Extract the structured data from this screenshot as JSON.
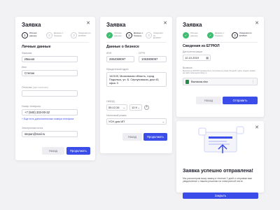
{
  "form_personal": {
    "title": "Заявка",
    "steps": [
      {
        "num": "1",
        "label": "Личные данные"
      },
      {
        "num": "2",
        "label": "Данные о бизнесе"
      },
      {
        "num": "3",
        "label": "Сведения из ЕГРЮЛ"
      }
    ],
    "section": "Личные данные",
    "lastname_label": "Фамилия",
    "lastname_value": "Иванов",
    "firstname_label": "Имя",
    "firstname_value": "Степан",
    "patronymic_label": "Отчество",
    "patronymic_hint": "(при наличии)",
    "phone_label": "Номер телефона",
    "phone_value": "+7 (940) 333-00-32",
    "add_phone": "+ Еще есть дополнительные номера телефона",
    "email_label": "Электронная почта",
    "email_value": "stepan@mail.ru",
    "back_label": "Назад",
    "next_label": "Продолжить"
  },
  "form_business": {
    "title": "Заявка",
    "steps": [
      {
        "num": "✓",
        "label": "Личные данные"
      },
      {
        "num": "2",
        "label": "Данные о бизнесе"
      },
      {
        "num": "3",
        "label": "Сведения из ЕГРЮЛ"
      }
    ],
    "section": "Данные о бизнесе",
    "inn_label": "ИНН",
    "inn_value": "2864069097",
    "ogrn_label": "ОГРН",
    "ogrn_value": "1053809097",
    "address_label": "Юридический адрес",
    "address_value": "142100, Московская область, город Подольск, ул. Б. Серпуховская, дом 43, офис 3",
    "okved_label": "ОКВЭД",
    "okved_a": "55.12.34",
    "okved_b": "12.9",
    "tax_label": "Налоговый режим",
    "tax_value": "УСН для ИП",
    "back_label": "Назад",
    "next_label": "Продолжить"
  },
  "form_egrul": {
    "title": "Заявка",
    "steps": [
      {
        "num": "✓",
        "label": "Личные данные"
      },
      {
        "num": "✓",
        "label": "Данные о бизнесе"
      },
      {
        "num": "3",
        "label": "Сведения из ЕГРЮЛ"
      }
    ],
    "section": "Сведения из ЕГРЮЛ",
    "reg_date_label": "Дата регистрации",
    "reg_date_value": "12.10.2019",
    "extract_label": "Выписка",
    "extract_hint": "Выписка из ЕГРЮЛ должна быть получена не ранее 30 дней с даты подачи заявки на сайте www.egrul.nalog.ru",
    "file_name": "Выписка.xlsx",
    "back_label": "Назад",
    "submit_label": "Отправить"
  },
  "success": {
    "title": "Заявка успешно отправлена!",
    "text": "Мы рассмотрим вашу заявку в течение 2 дней и отправим вам уведомление о нашем решении на электронной почте.",
    "close_label": "Закрыть"
  },
  "colors": {
    "accent": "#3a4de8",
    "done": "#3ebd70"
  }
}
